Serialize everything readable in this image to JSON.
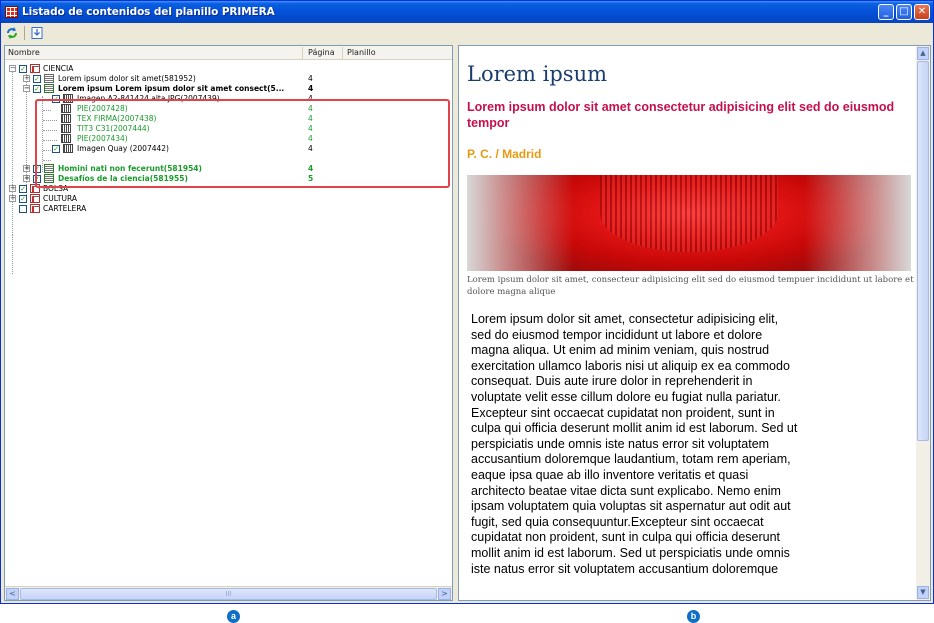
{
  "window": {
    "title": "Listado de contenidos del planillo PRIMERA",
    "controls": [
      "minimize",
      "maximize",
      "close"
    ]
  },
  "toolbar": {
    "refresh_icon": "refresh-icon",
    "export_icon": "export-icon"
  },
  "tree": {
    "columns": {
      "name": "Nombre",
      "page": "Página",
      "planillo": "Planillo"
    },
    "items": [
      {
        "label": "CIENCIA",
        "page": ""
      },
      {
        "label": "Lorem ipsum dolor sit amet(581952)",
        "page": "4"
      },
      {
        "label": "Lorem ipsum Lorem ipsum dolor sit amet consect(5...",
        "page": "4"
      },
      {
        "label": "Imagen A2-841424 alta.JPG(2007439)",
        "page": "4"
      },
      {
        "label": "PIE(2007428)",
        "page": "4"
      },
      {
        "label": "TEX FIRMA(2007438)",
        "page": "4"
      },
      {
        "label": "TIT3 C31(2007444)",
        "page": "4"
      },
      {
        "label": "PIE(2007434)",
        "page": "4"
      },
      {
        "label": "Imagen Quay (2007442)",
        "page": "4"
      },
      {
        "label": "Homini nati non fecerunt(581954)",
        "page": "4"
      },
      {
        "label": "Desafíos de la ciencia(581955)",
        "page": "5"
      },
      {
        "label": "BOLSA",
        "page": ""
      },
      {
        "label": "CULTURA",
        "page": ""
      },
      {
        "label": "CARTELERA",
        "page": ""
      }
    ],
    "scroll_grip": "III"
  },
  "article": {
    "title": "Lorem ipsum",
    "subtitle": "Lorem ipsum dolor sit amet consectetur adipisicing elit sed do eiusmod tempor",
    "author": "P. C. / Madrid",
    "caption": "Lorem ipsum dolor sit amet, consecteur adipisicing elit sed do eiusmod tempuer incididunt ut labore et dolore magna alique",
    "body": "Lorem ipsum dolor sit amet, consectetur adipisicing elit, sed do eiusmod tempor incididunt ut labore et dolore magna aliqua. Ut enim ad minim veniam, quis nostrud exercitation ullamco laboris nisi ut aliquip ex ea commodo consequat. Duis aute irure dolor in reprehenderit in voluptate velit esse cillum dolore eu fugiat nulla pariatur. Excepteur sint occaecat cupidatat non proident, sunt in culpa qui officia deserunt mollit anim id est laborum. Sed ut perspiciatis unde omnis iste natus error sit voluptatem accusantium doloremque laudantium, totam rem aperiam, eaque ipsa quae ab illo inventore veritatis et quasi architecto beatae vitae dicta sunt explicabo. Nemo enim ipsam voluptatem quia voluptas sit aspernatur aut odit aut fugit, sed quia consequuntur.Excepteur sint occaecat cupidatat non proident, sunt in culpa qui officia deserunt mollit anim id est laborum. Sed ut perspiciatis unde omnis iste natus error sit voluptatem accusantium doloremque"
  },
  "badges": {
    "a": "a",
    "b": "b"
  },
  "colors": {
    "titlebar": "#0550d8",
    "highlight": "#e0434a",
    "green_text": "#1a9b2c",
    "subtitle": "#c4104d",
    "author": "#e59a12"
  }
}
